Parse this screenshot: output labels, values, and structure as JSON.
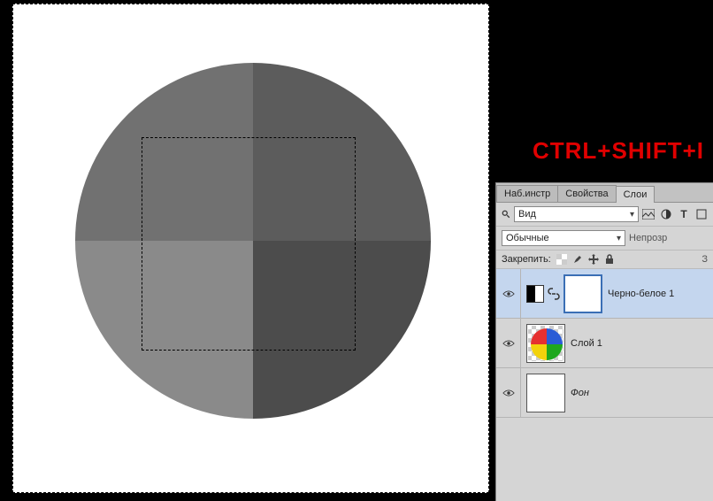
{
  "hotkey": "CTRL+SHIFT+I",
  "tabs": {
    "presets": "Наб.инстр",
    "properties": "Свойства",
    "layers": "Слои"
  },
  "search": {
    "label": "Вид"
  },
  "blend": {
    "mode": "Обычные",
    "opacity_label": "Непрозр"
  },
  "lock": {
    "label": "Закрепить:",
    "fill_short": "З"
  },
  "layers": [
    {
      "name": "Черно-белое 1",
      "type": "adjustment",
      "selected": true
    },
    {
      "name": "Слой 1",
      "type": "image",
      "selected": false
    },
    {
      "name": "Фон",
      "type": "background",
      "selected": false
    }
  ],
  "filter_icons": {
    "image": "image-filter-icon",
    "adjust": "adjust-filter-icon",
    "text": "T",
    "shape": "shape-filter-icon"
  }
}
